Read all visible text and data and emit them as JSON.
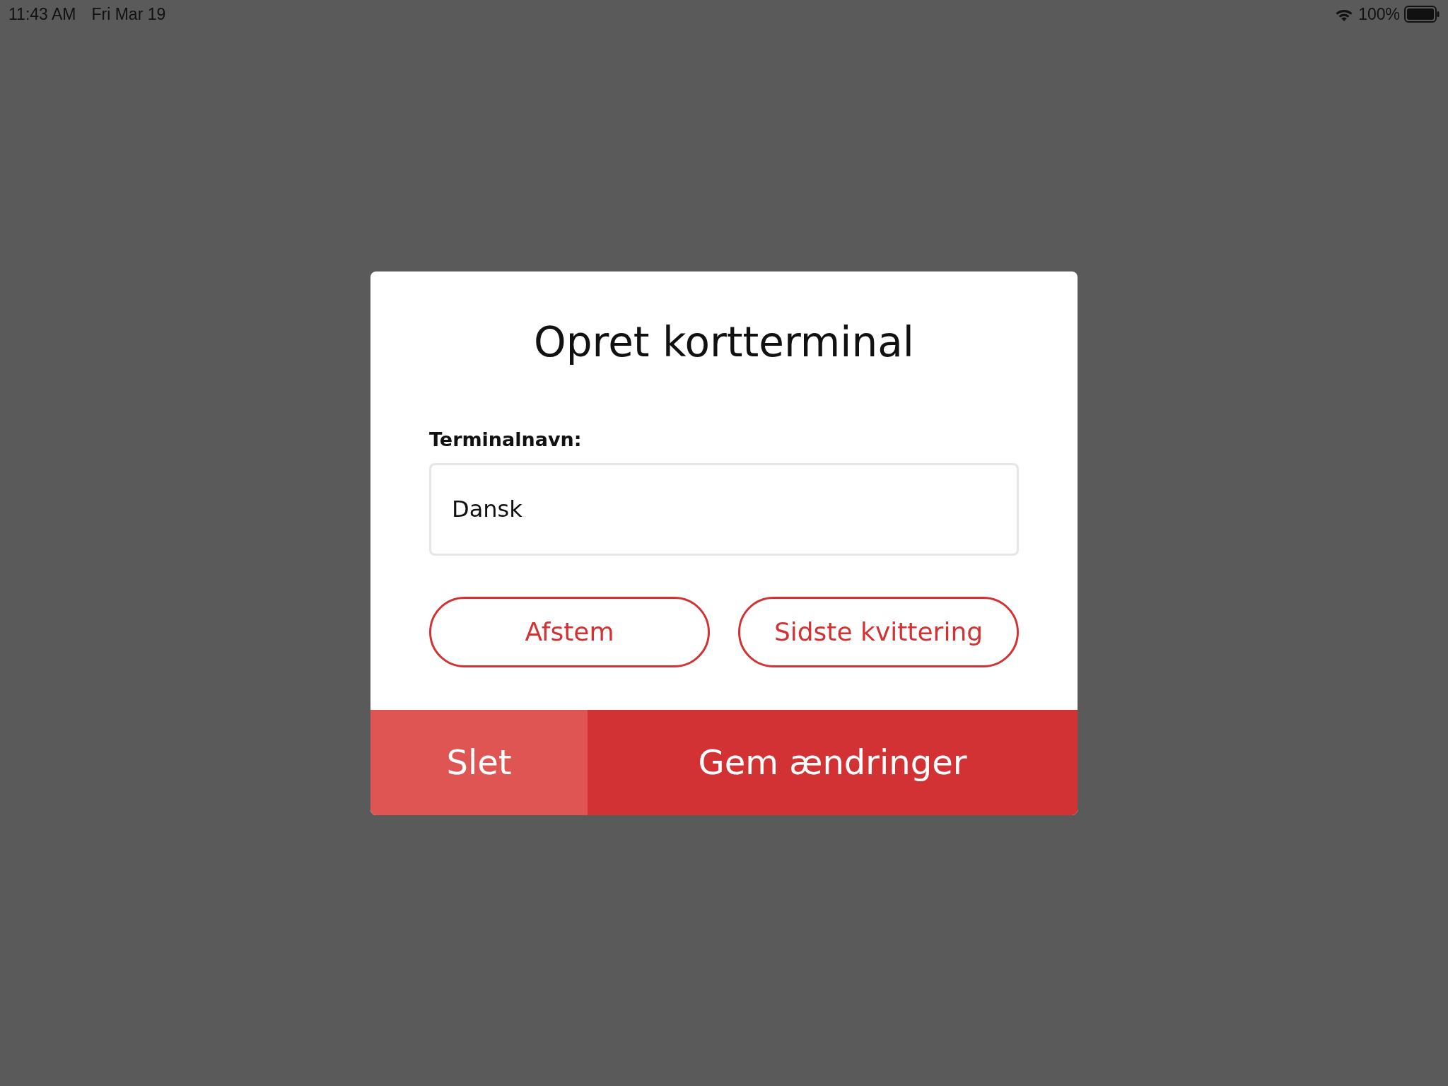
{
  "status_bar": {
    "time": "11:43 AM",
    "date": "Fri Mar 19",
    "battery": "100%"
  },
  "dialog": {
    "title": "Opret kortterminal",
    "field": {
      "label": "Terminalnavn:",
      "value": "Dansk"
    },
    "actions": [
      "Afstem",
      "Sidste kvittering"
    ],
    "footer": [
      {
        "label": "Slet",
        "kind": "secondary"
      },
      {
        "label": "Gem ændringer",
        "kind": "primary"
      }
    ]
  }
}
